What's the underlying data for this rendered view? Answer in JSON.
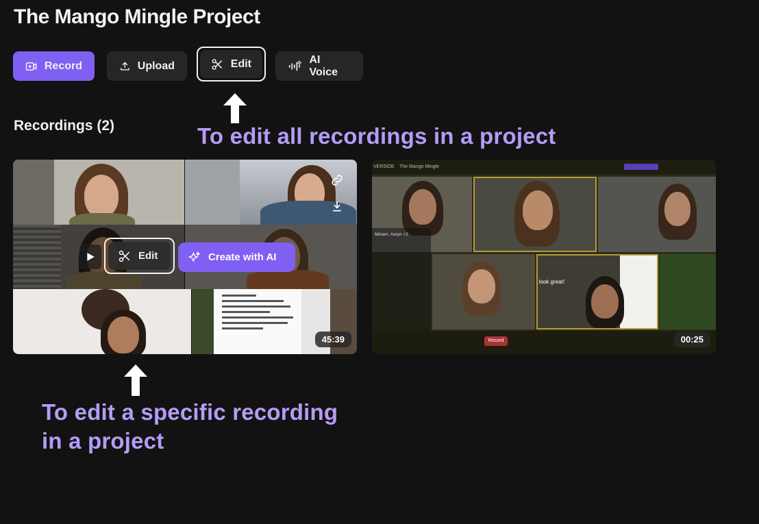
{
  "project": {
    "title": "The Mango Mingle Project"
  },
  "toolbar": {
    "record_label": "Record",
    "upload_label": "Upload",
    "edit_label": "Edit",
    "ai_voice_label": "AI Voice"
  },
  "annotations": {
    "top": "To edit all recordings in a project",
    "bottom_line1": "To edit a specific recording",
    "bottom_line2": "in a project"
  },
  "recordings": {
    "heading": "Recordings (2)",
    "items": [
      {
        "edit_label": "Edit",
        "create_ai_label": "Create with AI",
        "duration": "45:39"
      },
      {
        "duration": "00:25",
        "top_bar_left": "The Mango Mingle",
        "brand_partial": "VERSIDE",
        "caption": "You look great!",
        "record_label": "Record"
      }
    ]
  },
  "colors": {
    "accent": "#7f60f2",
    "annotation": "#b49cf6",
    "background": "#121212",
    "button_dark": "#262626"
  }
}
